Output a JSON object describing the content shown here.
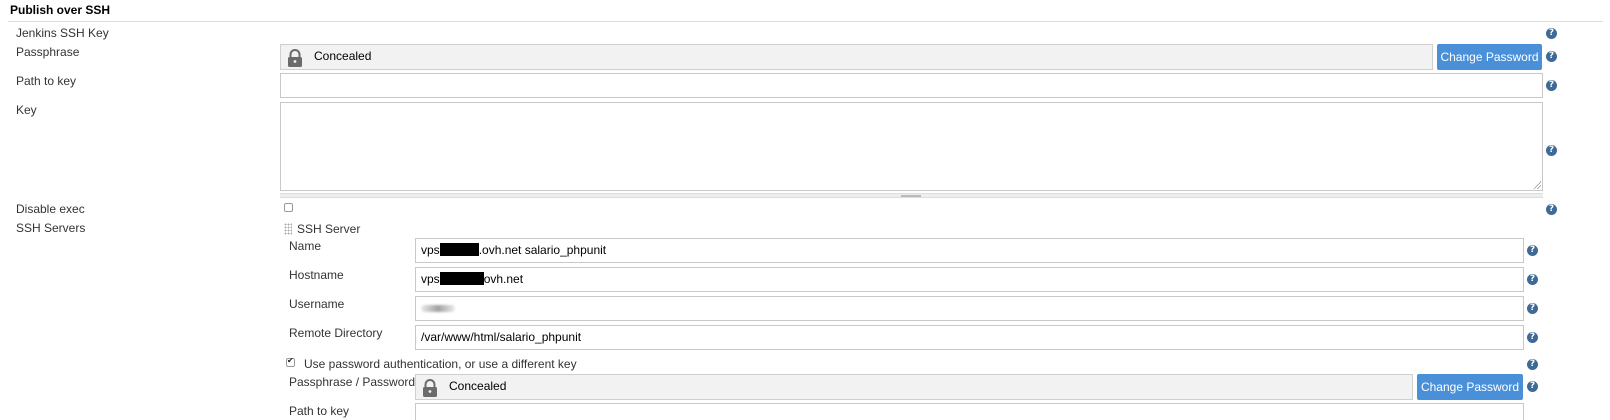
{
  "section": {
    "title": "Publish over SSH"
  },
  "fields": {
    "jenkins_ssh_key": {
      "label": "Jenkins SSH Key"
    },
    "passphrase": {
      "label": "Passphrase",
      "value": "Concealed",
      "button": "Change Password"
    },
    "path_to_key": {
      "label": "Path to key",
      "value": ""
    },
    "key": {
      "label": "Key",
      "value": ""
    },
    "disable_exec": {
      "label": "Disable exec",
      "checked": false
    }
  },
  "ssh_servers": {
    "label": "SSH Servers",
    "server_header": "SSH Server",
    "name": {
      "label": "Name",
      "prefix": "vps",
      "suffix": ".ovh.net salario_phpunit"
    },
    "hostname": {
      "label": "Hostname",
      "prefix": "vps",
      "suffix": "ovh.net"
    },
    "username": {
      "label": "Username"
    },
    "remote_directory": {
      "label": "Remote Directory",
      "value": "/var/www/html/salario_phpunit"
    },
    "use_password_auth": {
      "label": "Use password authentication, or use a different key",
      "checked": true
    },
    "passphrase_password": {
      "label": "Passphrase / Password",
      "value": "Concealed",
      "button": "Change Password"
    },
    "path_to_key": {
      "label": "Path to key"
    }
  },
  "colors": {
    "button": "#4a90d9",
    "help": "#3d6a96"
  }
}
